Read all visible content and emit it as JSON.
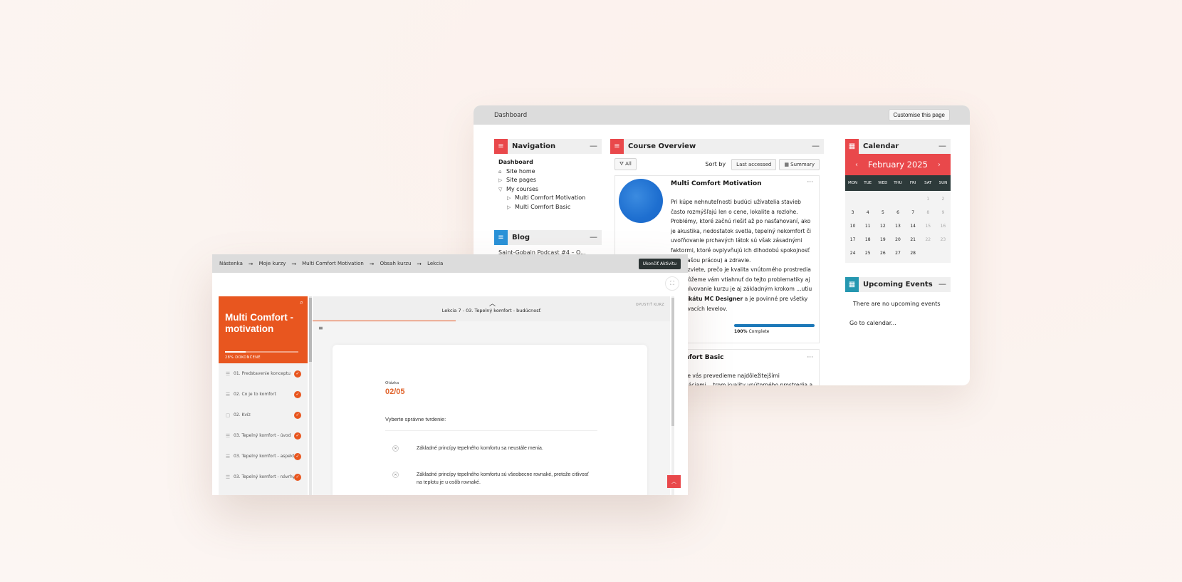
{
  "dashboard": {
    "breadcrumb": "Dashboard",
    "customise_label": "Customise this page",
    "navigation": {
      "title": "Navigation",
      "items": [
        {
          "label": "Dashboard"
        },
        {
          "label": "Site home"
        },
        {
          "label": "Site pages"
        },
        {
          "label": "My courses"
        },
        {
          "label": "Multi Comfort Motivation"
        },
        {
          "label": "Multi Comfort Basic"
        }
      ]
    },
    "blog": {
      "title": "Blog",
      "first_entry": "Saint-Gobain Podcast #4 – O..."
    },
    "course_overview": {
      "title": "Course Overview",
      "filter_label": "All",
      "sort_by_label": "Sort by",
      "sort_value": "Last accessed",
      "view_label": "Summary",
      "courses": [
        {
          "title": "Multi Comfort Motivation",
          "description_1": "Pri kúpe nehnuteľnosti budúci užívatelia stavieb často rozmýšľajú len o cene, lokalite a rozlohe. Problémy, ktoré začnú riešiť až po nasťahovaní, ako je akustika, nedostatok svetla, tepelný nekomfort či uvoľňovanie prchavých látok sú však zásadnými faktormi, ktoré ovplyvňujú ich dlhodobú spokojnosť (aj s vašou prácou) a zdravie.",
          "description_2a": "...a dozviete, prečo je kvalita vnútorného prostredia ...pomôžeme vám vtiahnuť do tejto problematiky aj ...Absolvovanie kurzu je aj základným krokom ...utiu ",
          "description_bold": "certifikátu MC Designer",
          "description_2b": " a je povinné pre všetky ...delávacích levelov.",
          "progress_percent": 100,
          "progress_bold": "100%",
          "progress_text": " Complete"
        },
        {
          "title": "...omfort Basic",
          "description": "...kurze vás prevedieme najdôležitejšími informáciami ...trom kvality vnútorného prostredia a ich vplyvom na"
        }
      ]
    },
    "calendar": {
      "title": "Calendar",
      "month": "February 2025",
      "prev": "‹",
      "next": "›",
      "days_of_week": [
        "MON",
        "TUE",
        "WED",
        "THU",
        "FRI",
        "SAT",
        "SUN"
      ],
      "days": [
        "",
        "",
        "",
        "",
        "",
        "1",
        "2",
        "3",
        "4",
        "5",
        "6",
        "7",
        "8",
        "9",
        "10",
        "11",
        "12",
        "13",
        "14",
        "15",
        "16",
        "17",
        "18",
        "19",
        "20",
        "21",
        "22",
        "23",
        "24",
        "25",
        "26",
        "27",
        "28",
        "",
        ""
      ]
    },
    "upcoming_events": {
      "title": "Upcoming Events",
      "empty_text": "There are no upcoming events",
      "go_to_calendar": "Go to calendar..."
    }
  },
  "lesson": {
    "breadcrumb": [
      "Nástenka",
      "Moje kurzy",
      "Multi Comfort Motivation",
      "Obsah kurzu",
      "Lekcia"
    ],
    "breadcrumb_sep": "➞",
    "end_activity_label": "Ukončiť Aktivitu",
    "sidebar": {
      "course_title": "Multi Comfort - motivation",
      "progress_percent": 28,
      "progress_label": "28% DOKONČENÉ",
      "items": [
        {
          "label": "01. Predstavenie konceptu",
          "icon": "text-lines-icon"
        },
        {
          "label": "02. Čo je to komfort",
          "icon": "text-lines-icon"
        },
        {
          "label": "02. Kvíz",
          "icon": "quiz-icon"
        },
        {
          "label": "03. Tepelný komfort - úvod",
          "icon": "text-lines-icon"
        },
        {
          "label": "03. Tepelný komfort - aspekty",
          "icon": "text-lines-icon"
        },
        {
          "label": "03. Tepelný komfort - návrhy",
          "icon": "text-lines-icon"
        }
      ]
    },
    "main": {
      "lesson_title": "Lekcia 7 - 03. Tepelný komfort - budúcnosť",
      "leave_course": "OPUSTIŤ KURZ",
      "lesson_progress_percent": 40,
      "question_label": "Otázka",
      "question_number": "02/05",
      "prompt": "Vyberte správne tvrdenie:",
      "options": [
        "Základné princípy tepelného komfortu sa neustále menia.",
        "Základné princípy tepelného komfortu sú všeobecne rovnaké, pretože citlivosť na teplotu je u osôb rovnaké."
      ]
    }
  },
  "colors": {
    "moodle_red": "#e9484b",
    "moodle_blue": "#2a92d8",
    "moodle_teal": "#2597b0",
    "lesson_orange": "#e8561f",
    "progress_blue": "#1c78b8"
  }
}
